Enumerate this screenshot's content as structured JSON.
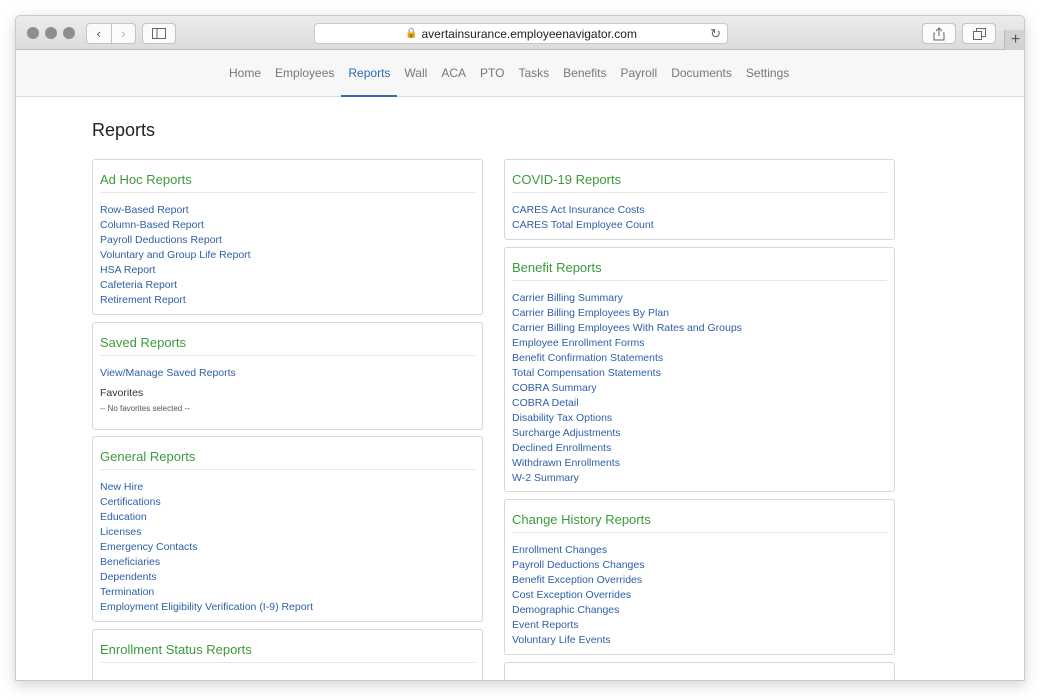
{
  "browser": {
    "url": "avertainsurance.employeenavigator.com"
  },
  "nav": {
    "items": [
      "Home",
      "Employees",
      "Reports",
      "Wall",
      "ACA",
      "PTO",
      "Tasks",
      "Benefits",
      "Payroll",
      "Documents",
      "Settings"
    ],
    "active": "Reports"
  },
  "page": {
    "title": "Reports"
  },
  "panels": {
    "adhoc": {
      "title": "Ad Hoc Reports",
      "links": [
        "Row-Based Report",
        "Column-Based Report",
        "Payroll Deductions Report",
        "Voluntary and Group Life Report",
        "HSA Report",
        "Cafeteria Report",
        "Retirement Report"
      ]
    },
    "saved": {
      "title": "Saved Reports",
      "links": [
        "View/Manage Saved Reports"
      ],
      "favorites_label": "Favorites",
      "favorites_empty": "-- No favorites selected --"
    },
    "general": {
      "title": "General Reports",
      "links": [
        "New Hire",
        "Certifications",
        "Education",
        "Licenses",
        "Emergency Contacts",
        "Beneficiaries",
        "Dependents",
        "Termination",
        "Employment Eligibility Verification (I-9) Report"
      ]
    },
    "enrollment_status": {
      "title": "Enrollment Status Reports"
    },
    "covid": {
      "title": "COVID-19 Reports",
      "links": [
        "CARES Act Insurance Costs",
        "CARES Total Employee Count"
      ]
    },
    "benefit": {
      "title": "Benefit Reports",
      "links": [
        "Carrier Billing Summary",
        "Carrier Billing Employees By Plan",
        "Carrier Billing Employees With Rates and Groups",
        "Employee Enrollment Forms",
        "Benefit Confirmation Statements",
        "Total Compensation Statements",
        "COBRA Summary",
        "COBRA Detail",
        "Disability Tax Options",
        "Surcharge Adjustments",
        "Declined Enrollments",
        "Withdrawn Enrollments",
        "W-2 Summary"
      ]
    },
    "change_history": {
      "title": "Change History Reports",
      "links": [
        "Enrollment Changes",
        "Payroll Deductions Changes",
        "Benefit Exception Overrides",
        "Cost Exception Overrides",
        "Demographic Changes",
        "Event Reports",
        "Voluntary Life Events"
      ]
    }
  },
  "colors": {
    "link": "#2d5fa7",
    "section_title": "#3c9a3c",
    "active_tab": "#2a6bb3"
  }
}
